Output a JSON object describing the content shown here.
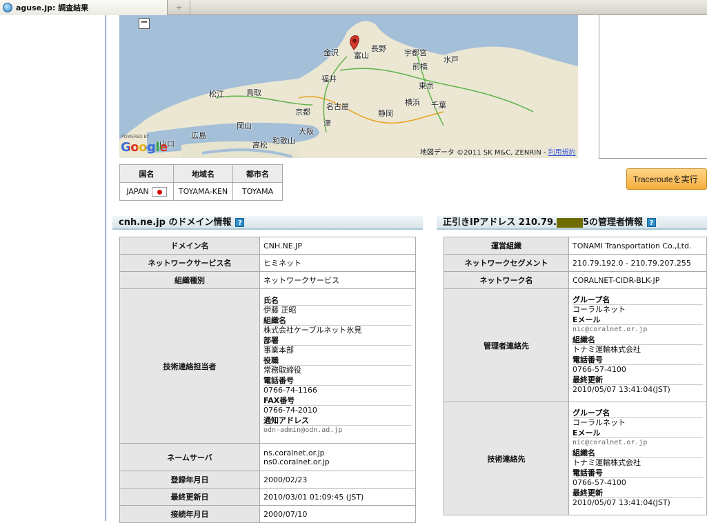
{
  "browser": {
    "tab_title": "aguse.jp: 調査結果",
    "new_tab": "+"
  },
  "map": {
    "zoom_out": "−",
    "powered_by": "POWERED BY",
    "google": "Google",
    "copyright": "地図データ ©2011 SK M&C, ZENRIN - ",
    "terms_link": "利用規約",
    "cities": [
      "金沢",
      "富山",
      "長野",
      "宇都宮",
      "前橋",
      "水戸",
      "福井",
      "松江",
      "鳥取",
      "東京",
      "京都",
      "名古屋",
      "横浜",
      "千葉",
      "岡山",
      "津",
      "静岡",
      "広島",
      "大阪",
      "山口",
      "高松",
      "和歌山"
    ]
  },
  "location": {
    "headers": [
      "国名",
      "地域名",
      "都市名"
    ],
    "row": [
      "JAPAN",
      "TOYAMA-KEN",
      "TOYAMA"
    ]
  },
  "traceroute_button": "Tracerouteを実行",
  "domain_section": {
    "title": "cnh.ne.jp のドメイン情報",
    "help": "?",
    "rows": [
      {
        "label": "ドメイン名",
        "value": "CNH.NE.JP"
      },
      {
        "label": "ネットワークサービス名",
        "value": "ヒミネット"
      },
      {
        "label": "組織種別",
        "value": "ネットワークサービス"
      }
    ],
    "tech_label": "技術連絡担当者",
    "tech": [
      {
        "k": "氏名",
        "v": "伊藤 正昭"
      },
      {
        "k": "組織名",
        "v": "株式会社ケーブルネット氷見"
      },
      {
        "k": "部署",
        "v": "事業本部"
      },
      {
        "k": "役職",
        "v": "常務取締役"
      },
      {
        "k": "電話番号",
        "v": "0766-74-1166"
      },
      {
        "k": "FAX番号",
        "v": "0766-74-2010"
      },
      {
        "k": "通知アドレス",
        "v": "odn-admin@odn.ad.jp"
      }
    ],
    "ns_label": "ネームサーバ",
    "ns": [
      "ns.coralnet.or.jp",
      "ns0.coralnet.or.jp"
    ],
    "rows2": [
      {
        "label": "登録年月日",
        "value": "2000/02/23"
      },
      {
        "label": "最終更新日",
        "value": "2010/03/01 01:09:45 (JST)"
      },
      {
        "label": "接続年月日",
        "value": "2000/07/10"
      }
    ]
  },
  "ip_section": {
    "title_prefix": "正引きIPアドレス 210.79.",
    "title_suffix": "5の管理者情報",
    "help": "?",
    "rows": [
      {
        "label": "運営組織",
        "value": "TONAMI Transportation Co.,Ltd."
      },
      {
        "label": "ネットワークセグメント",
        "value": "210.79.192.0 - 210.79.207.255"
      },
      {
        "label": "ネットワーク名",
        "value": "CORALNET-CIDR-BLK-JP"
      }
    ],
    "admin_label": "管理者連絡先",
    "admin": [
      {
        "k": "グループ名",
        "v": "コーラルネット"
      },
      {
        "k": "Eメール",
        "v": "nic@coralnet.or.jp"
      },
      {
        "k": "組織名",
        "v": "トナミ運輸株式会社"
      },
      {
        "k": "電話番号",
        "v": "0766-57-4100"
      },
      {
        "k": "最終更新",
        "v": "2010/05/07 13:41:04(JST)"
      }
    ],
    "tech_label": "技術連絡先",
    "tech": [
      {
        "k": "グループ名",
        "v": "コーラルネット"
      },
      {
        "k": "Eメール",
        "v": "nic@coralnet.or.jp"
      },
      {
        "k": "組織名",
        "v": "トナミ運輸株式会社"
      },
      {
        "k": "電話番号",
        "v": "0766-57-4100"
      },
      {
        "k": "最終更新",
        "v": "2010/05/07 13:41:04(JST)"
      }
    ]
  }
}
